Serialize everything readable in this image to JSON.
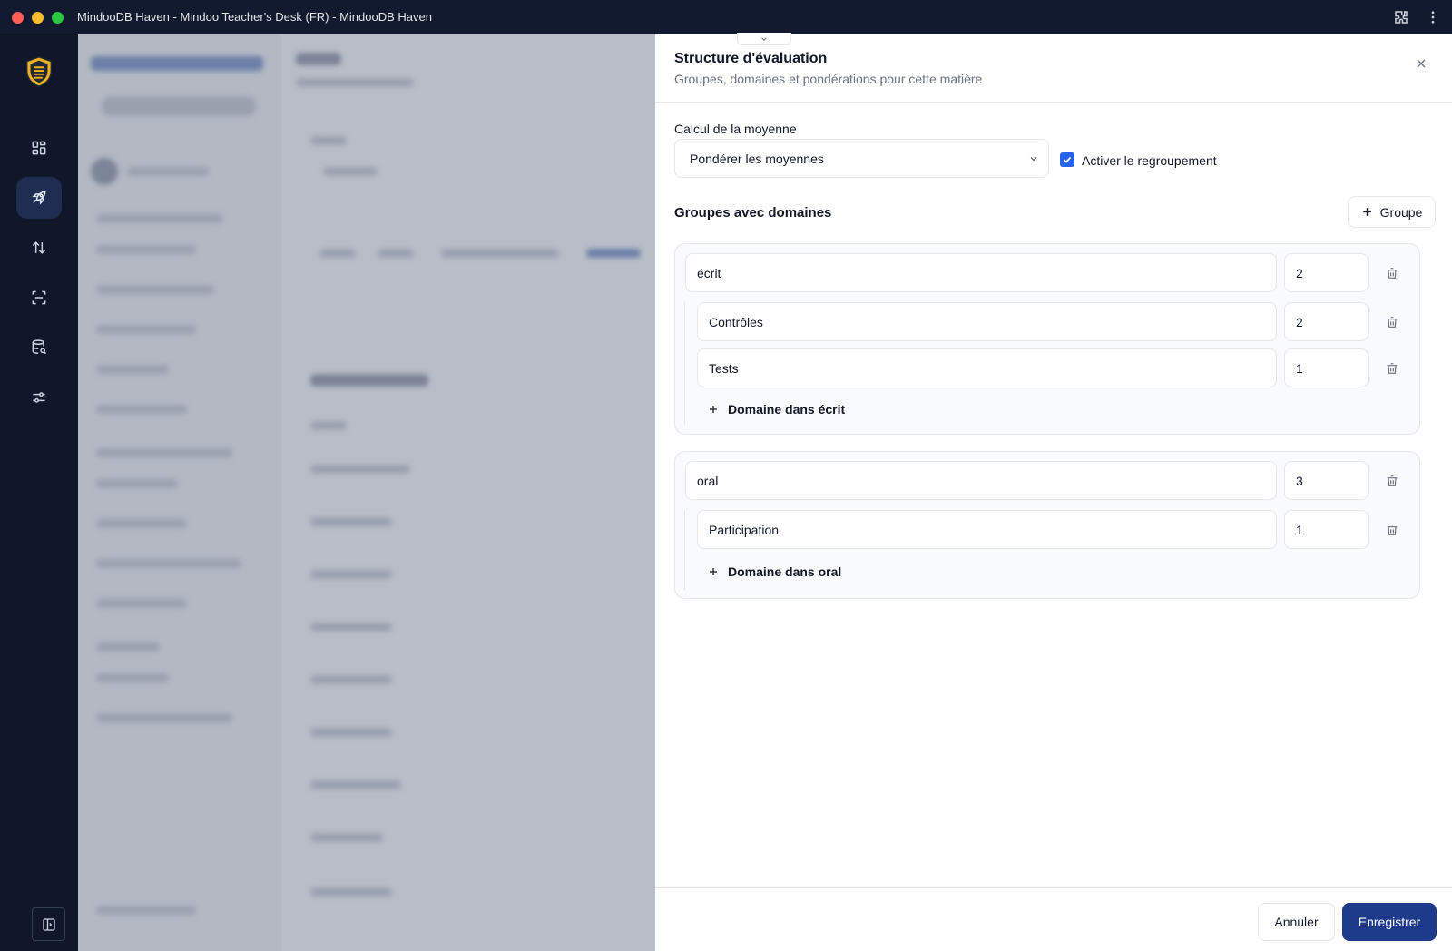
{
  "window": {
    "title": "MindooDB Haven - Mindoo Teacher's Desk (FR) - MindooDB Haven"
  },
  "rail": {
    "logo": "shield-logo",
    "items": [
      {
        "name": "dashboard",
        "icon": "grid-icon",
        "active": false
      },
      {
        "name": "launch",
        "icon": "rocket-icon",
        "active": true
      },
      {
        "name": "sync",
        "icon": "arrows-up-down-icon",
        "active": false
      },
      {
        "name": "scan",
        "icon": "scan-icon",
        "active": false
      },
      {
        "name": "database-search",
        "icon": "database-search-icon",
        "active": false
      },
      {
        "name": "settings",
        "icon": "sliders-icon",
        "active": false
      }
    ]
  },
  "panel": {
    "title": "Structure d'évaluation",
    "subtitle": "Groupes, domaines et pondérations pour cette matière",
    "average_label": "Calcul de la moyenne",
    "average_mode": "Pondérer les moyennes",
    "grouping_checked": true,
    "grouping_label": "Activer le regroupement",
    "groups_title": "Groupes avec domaines",
    "add_group_label": "Groupe",
    "groups": [
      {
        "name": "écrit",
        "weight": "2",
        "domains": [
          {
            "name": "Contrôles",
            "weight": "2"
          },
          {
            "name": "Tests",
            "weight": "1"
          }
        ],
        "add_domain_label": "Domaine dans écrit"
      },
      {
        "name": "oral",
        "weight": "3",
        "domains": [
          {
            "name": "Participation",
            "weight": "1"
          }
        ],
        "add_domain_label": "Domaine dans oral"
      }
    ],
    "cancel_label": "Annuler",
    "save_label": "Enregistrer"
  },
  "colors": {
    "primary": "#1e3a8a",
    "checkbox": "#2563eb",
    "rail": "#0f1729",
    "rail_active": "#1e2d52"
  }
}
